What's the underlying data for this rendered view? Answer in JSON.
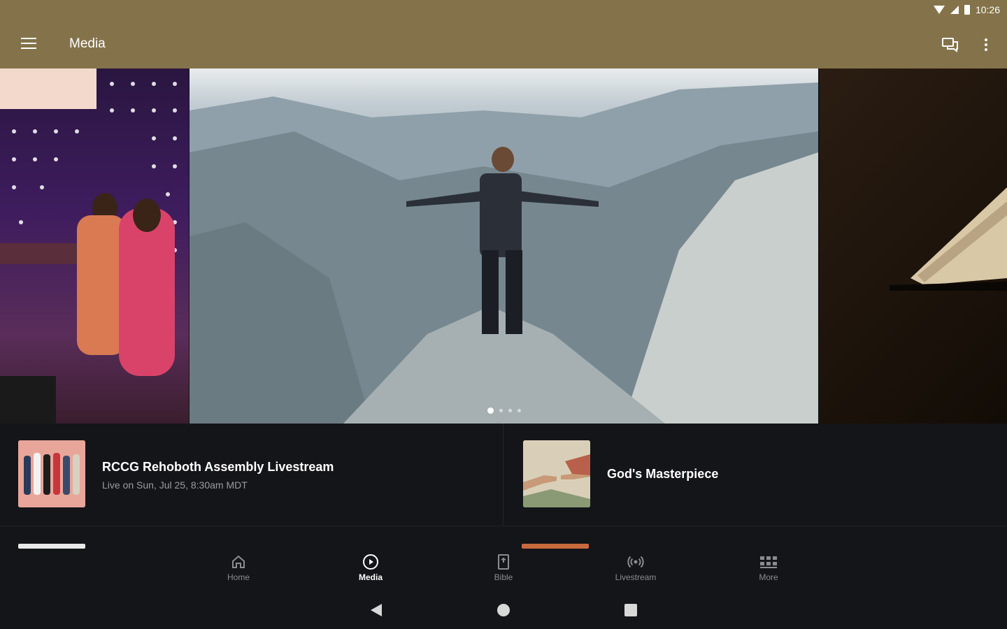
{
  "status_bar": {
    "time": "10:26"
  },
  "app_bar": {
    "title": "Media"
  },
  "colors": {
    "app_bar": "#84734a",
    "background": "#141518",
    "accent_peek": "#c86a3c"
  },
  "icons": {
    "menu": "hamburger-menu-icon",
    "chat": "chat-icon",
    "more": "more-vert-icon"
  },
  "carousel": {
    "active_index": 0,
    "slide_count": 4
  },
  "media_items": [
    {
      "title": "RCCG Rehoboth Assembly Livestream",
      "subtitle": "Live on Sun, Jul 25, 8:30am MDT"
    },
    {
      "title": "God's Masterpiece",
      "subtitle": ""
    }
  ],
  "bottom_nav": {
    "active": "Media",
    "items": [
      {
        "label": "Home",
        "icon": "home-icon"
      },
      {
        "label": "Media",
        "icon": "play-circle-icon"
      },
      {
        "label": "Bible",
        "icon": "bible-icon"
      },
      {
        "label": "Livestream",
        "icon": "livestream-icon"
      },
      {
        "label": "More",
        "icon": "grid-more-icon"
      }
    ]
  }
}
